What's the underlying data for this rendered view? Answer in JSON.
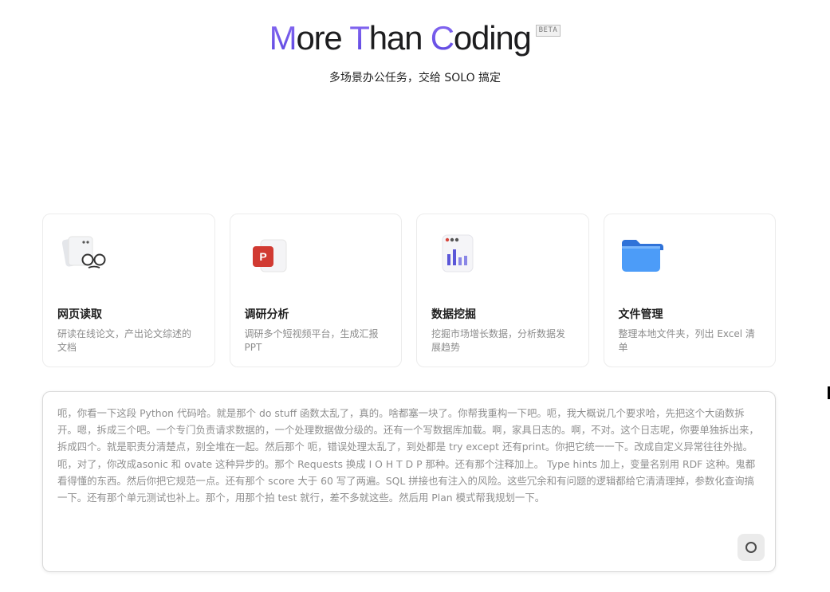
{
  "hero": {
    "title_parts": [
      {
        "accent": "M",
        "rest": "ore"
      },
      {
        "accent": "T",
        "rest": "han"
      },
      {
        "accent": "C",
        "rest": "oding"
      }
    ],
    "badge": "BETA",
    "subtitle": "多场景办公任务，交给 SOLO 搞定"
  },
  "cards": [
    {
      "title": "网页读取",
      "desc": "研读在线论文，产出论文综述的文档",
      "icon": "web-reading-icon"
    },
    {
      "title": "调研分析",
      "desc": "调研多个短视频平台，生成汇报PPT",
      "icon": "presentation-icon"
    },
    {
      "title": "数据挖掘",
      "desc": "挖掘市场增长数据，分析数据发展趋势",
      "icon": "bar-chart-icon"
    },
    {
      "title": "文件管理",
      "desc": "整理本地文件夹，列出 Excel 清单",
      "icon": "folder-icon"
    }
  ],
  "prompt": {
    "text": "呃，你看一下这段 Python 代码哈。就是那个 do stuff 函数太乱了，真的。啥都塞一块了。你帮我重构一下吧。呃，我大概说几个要求哈，先把这个大函数拆开。嗯，拆成三个吧。一个专门负责请求数据的，一个处理数据做分级的。还有一个写数据库加载。啊，家具日志的。啊，不对。这个日志呢，你要单独拆出来，拆成四个。就是职责分清楚点，别全堆在一起。然后那个 呃，错误处理太乱了，到处都是 try except 还有print。你把它统一一下。改成自定义异常往往外抛。呃，对了，你改成asonic 和 ovate 这种异步的。那个 Requests 换成 I O H T D P 那种。还有那个注释加上。 Type hints 加上，变量名别用 RDF 这种。鬼都看得懂的东西。然后你把它规范一点。还有那个 score 大于 60 写了两遍。SQL 拼接也有注入的风险。这些冗余和有问题的逻辑都给它清清理掉，参数化查询搞一下。还有那个单元测试也补上。那个，用那个拍 test 就行，差不多就这些。然后用 Plan 模式帮我规划一下。"
  },
  "colors": {
    "accent_top": "#8a6cf2",
    "accent_bottom": "#5a45e0",
    "ppt_red": "#d13a32",
    "folder_blue": "#3f8ef7"
  }
}
